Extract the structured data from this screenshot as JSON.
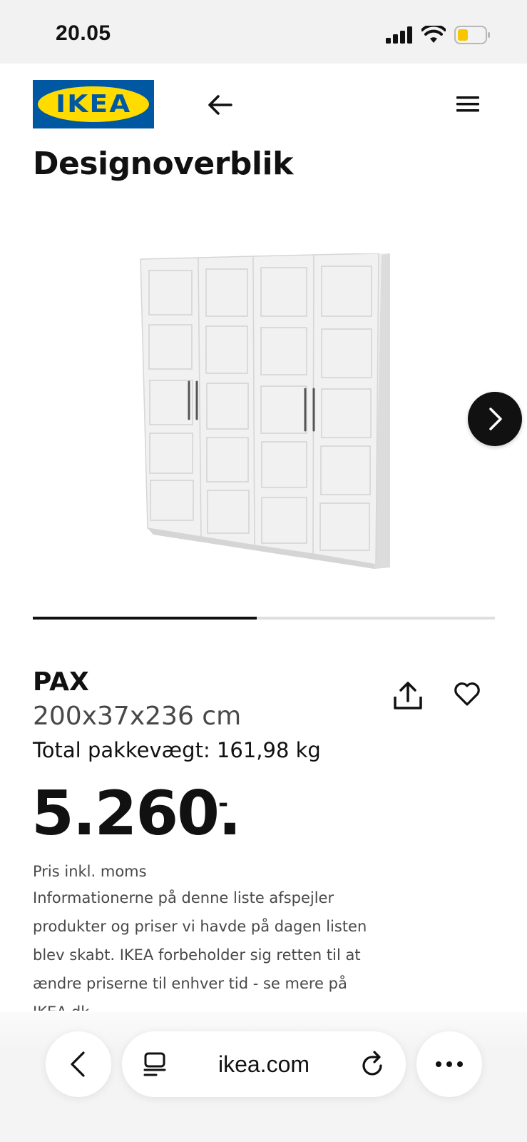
{
  "status_bar": {
    "time": "20.05",
    "icons": [
      "cellular-signal-icon",
      "wifi-icon",
      "battery-icon"
    ],
    "battery_color": "#f7c600"
  },
  "header": {
    "logo_text": "IKEA",
    "logo_colors": {
      "background": "#0058a3",
      "oval": "#ffdb00"
    },
    "back_icon": "arrow-left-icon",
    "menu_icon": "hamburger-menu-icon"
  },
  "page": {
    "title": "Designoverblik"
  },
  "gallery": {
    "image_subject": "white wardrobe",
    "next_icon": "chevron-right-icon",
    "progress_fraction": 0.485
  },
  "product": {
    "name": "PAX",
    "dimensions": "200x37x236 cm",
    "weight": "Total pakkevægt: 161,98 kg",
    "price": "5.260.",
    "price_suffix": "-",
    "price_note": "Pris inkl. moms",
    "disclaimer": "Informationerne på denne liste afspejler produkter og priser vi havde på dagen listen blev skabt. IKEA forbeholder sig retten til at ændre priserne til enhver tid - se mere på IKEA.dk",
    "share_icon": "share-icon",
    "favorite_icon": "heart-icon"
  },
  "browser": {
    "url": "ikea.com",
    "back_icon": "chevron-left-icon",
    "tabs_icon": "tabs-icon",
    "reload_icon": "reload-icon",
    "more_icon": "more-dots-icon"
  }
}
